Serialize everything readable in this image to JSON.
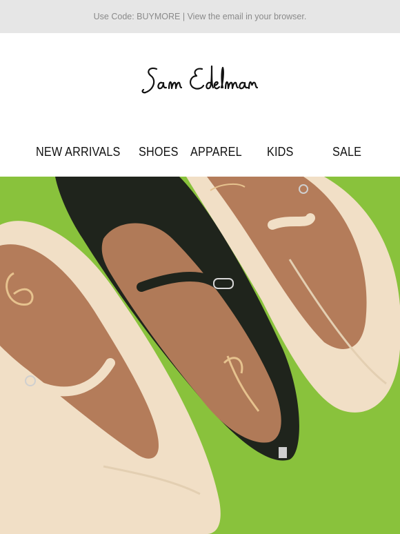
{
  "preheader": {
    "text": "Use Code: BUYMORE | View the email in your browser."
  },
  "brand": {
    "logo_text": "Sam Edelman"
  },
  "nav": {
    "items": [
      {
        "label": "NEW ARRIVALS"
      },
      {
        "label": "SHOES"
      },
      {
        "label": "APPAREL"
      },
      {
        "label": "KIDS"
      },
      {
        "label": "SALE"
      }
    ]
  },
  "colors": {
    "preheader_bg": "#e6e6e6",
    "hero_bg": "#8cc63f",
    "shoe_cream": "#efdcc4",
    "shoe_black": "#1f241c",
    "insole_tan": "#b07a58"
  }
}
